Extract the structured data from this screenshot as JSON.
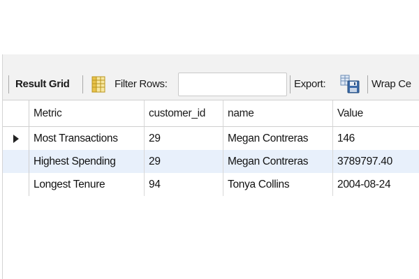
{
  "toolbar": {
    "result_grid_label": "Result Grid",
    "filter_rows_label": "Filter Rows:",
    "filter_value": "",
    "export_label": "Export:",
    "wrap_label": "Wrap Ce"
  },
  "table": {
    "columns": [
      "Metric",
      "customer_id",
      "name",
      "Value"
    ],
    "rows": [
      [
        "Most Transactions",
        "29",
        "Megan Contreras",
        "146"
      ],
      [
        "Highest Spending",
        "29",
        "Megan Contreras",
        "3789797.40"
      ],
      [
        "Longest Tenure",
        "94",
        "Tonya Collins",
        "2004-08-24"
      ]
    ],
    "selected_row_index": 0
  },
  "icons": {
    "grid": "result-grid-icon",
    "export": "export-icon",
    "row_marker": "current-row-arrow-icon"
  },
  "colors": {
    "toolbar_bg": "#f2f2f2",
    "alt_row_bg": "#e8f0fb"
  }
}
